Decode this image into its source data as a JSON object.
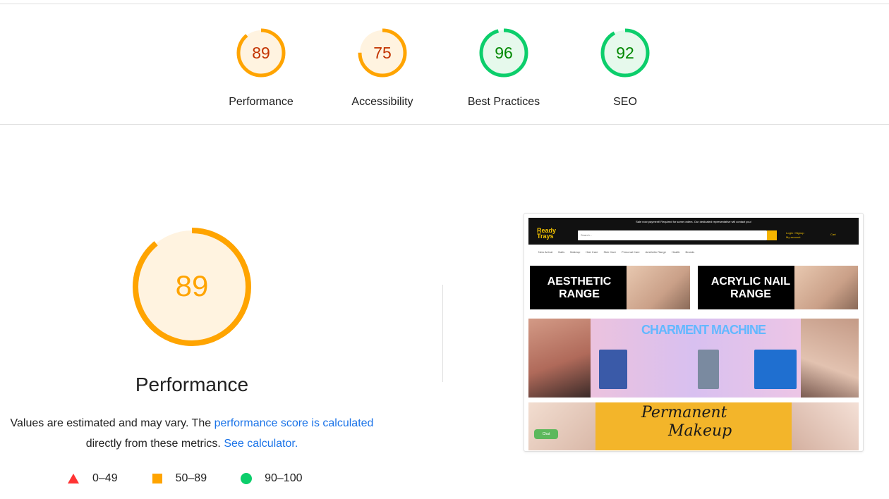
{
  "summary": {
    "gauges": [
      {
        "label": "Performance",
        "score": "89",
        "fraction": 0.89,
        "status": "average"
      },
      {
        "label": "Accessibility",
        "score": "75",
        "fraction": 0.75,
        "status": "average"
      },
      {
        "label": "Best Practices",
        "score": "96",
        "fraction": 0.96,
        "status": "pass"
      },
      {
        "label": "SEO",
        "score": "92",
        "fraction": 0.92,
        "status": "pass"
      }
    ]
  },
  "performance": {
    "score": "89",
    "fraction": 0.89,
    "title": "Performance",
    "desc_prefix": "Values are estimated and may vary. The ",
    "desc_link1": "performance score is calculated",
    "desc_middle": " directly from these metrics. ",
    "desc_link2": "See calculator."
  },
  "legend": {
    "fail": "0–49",
    "average": "50–89",
    "pass": "90–100"
  },
  "colors": {
    "average_stroke": "#ffa400",
    "average_text": "#c33300",
    "average_fill": "#fff3e0",
    "pass_stroke": "#0cce6b",
    "pass_text": "#008800",
    "pass_fill": "#e6f9ec",
    "fail": "#ff3333",
    "link": "#1a73e8",
    "big_text": "#ffa400"
  },
  "screenshot": {
    "announce": "Sale now payment! Required for some orders. Our dedicated representative will contact you!",
    "logo_line1": "Ready",
    "logo_line2": "Trays",
    "search_placeholder": "Search...",
    "account_line1": "Login / Signup",
    "account_line2": "My account",
    "cart": "Cart",
    "nav": [
      "New Arrival",
      "Nails",
      "Makeup",
      "Hair Care",
      "Skin Care",
      "Personal Care",
      "Aesthetic Range",
      "Health",
      "Brands"
    ],
    "banner1": "AESTHETIC RANGE",
    "banner2": "ACRYLIC NAIL RANGE",
    "banner3": "CHARMENT MACHINE",
    "banner4_line1": "Permanent",
    "banner4_line2": "Makeup",
    "chat": "Chat"
  }
}
